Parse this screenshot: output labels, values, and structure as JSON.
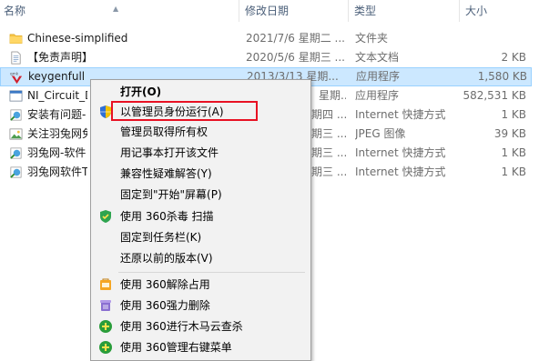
{
  "columns": {
    "name": "名称",
    "date": "修改日期",
    "type": "类型",
    "size": "大小"
  },
  "files": [
    {
      "icon": "folder-icon",
      "name": "Chinese-simplified",
      "date": "2021/7/6 星期二 ...",
      "type": "文件夹",
      "size": ""
    },
    {
      "icon": "text-file-icon",
      "name": "【免责声明】",
      "date": "2020/5/6 星期三 ...",
      "type": "文本文档",
      "size": "2 KB"
    },
    {
      "icon": "keygen-app-icon",
      "name": "keygenfull",
      "date": "2013/3/13 星期...",
      "type": "应用程序",
      "size": "1,580 KB"
    },
    {
      "icon": "app-icon",
      "name": "NI_Circuit_D",
      "date": "星期...",
      "type": "应用程序",
      "size": "582,531 KB"
    },
    {
      "icon": "internet-shortcut-icon",
      "name": "安装有问题-",
      "date": "星期四 ...",
      "type": "Internet 快捷方式",
      "size": "1 KB"
    },
    {
      "icon": "jpeg-image-icon",
      "name": "关注羽兔网免",
      "date": "星期三 ...",
      "type": "JPEG 图像",
      "size": "39 KB"
    },
    {
      "icon": "internet-shortcut-icon",
      "name": "羽兔网-软件",
      "date": "星期三 ...",
      "type": "Internet 快捷方式",
      "size": "1 KB"
    },
    {
      "icon": "internet-shortcut-icon",
      "name": "羽兔网软件T",
      "date": "星期三 ...",
      "type": "Internet 快捷方式",
      "size": "1 KB"
    }
  ],
  "context_menu": {
    "items": [
      {
        "label": "打开(O)",
        "icon": "",
        "bold": true
      },
      {
        "label": "以管理员身份运行(A)",
        "icon": "uac-shield-icon",
        "bold": false
      },
      {
        "label": "管理员取得所有权",
        "icon": "",
        "bold": false
      },
      {
        "label": "用记事本打开该文件",
        "icon": "",
        "bold": false
      },
      {
        "label": "兼容性疑难解答(Y)",
        "icon": "",
        "bold": false
      },
      {
        "label": "固定到\"开始\"屏幕(P)",
        "icon": "",
        "bold": false
      },
      {
        "label": "使用 360杀毒 扫描",
        "icon": "360-shield-icon",
        "bold": false
      },
      {
        "label": "固定到任务栏(K)",
        "icon": "",
        "bold": false
      },
      {
        "label": "还原以前的版本(V)",
        "icon": "",
        "bold": false
      },
      {
        "label": "使用 360解除占用",
        "icon": "360-unlock-icon",
        "bold": false
      },
      {
        "label": "使用 360强力删除",
        "icon": "360-delete-icon",
        "bold": false
      },
      {
        "label": "使用 360进行木马云查杀",
        "icon": "360-cloud-scan-icon",
        "bold": false
      },
      {
        "label": "使用 360管理右键菜单",
        "icon": "360-menu-manager-icon",
        "bold": false
      }
    ]
  },
  "colors": {
    "selection": "#cce8ff",
    "highlight_box": "#e81123",
    "menu_bg": "#f2f2f2"
  }
}
